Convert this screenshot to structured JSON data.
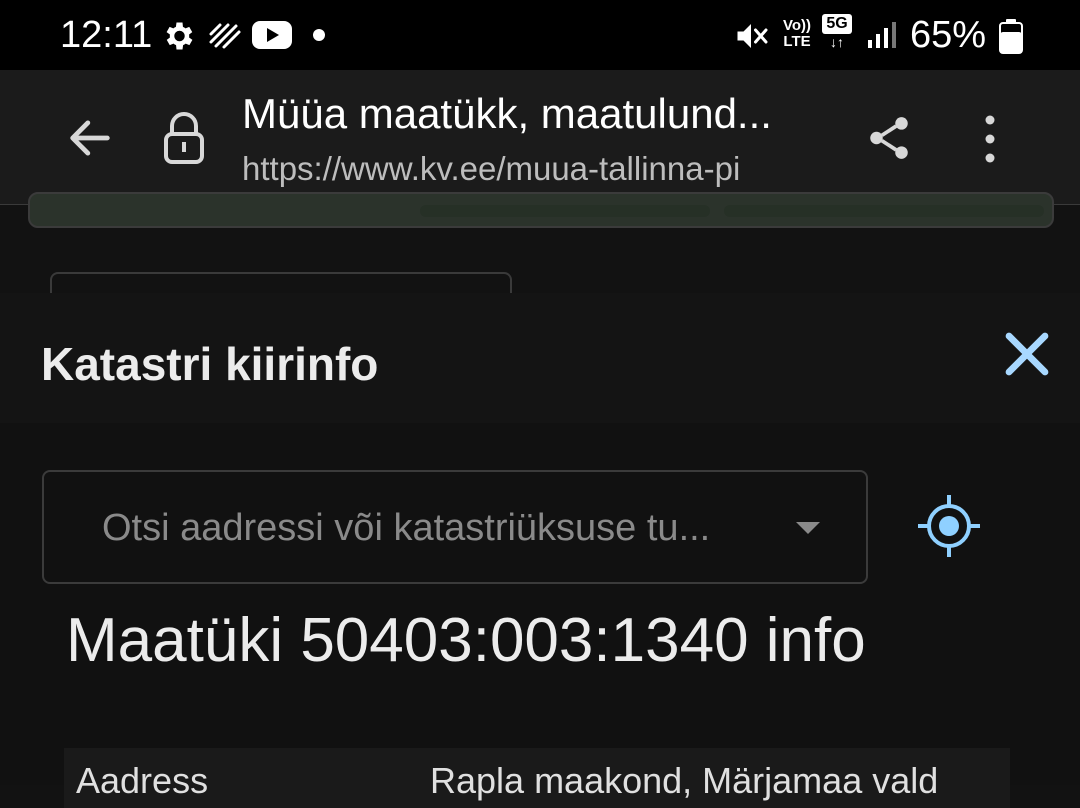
{
  "status_bar": {
    "time": "12:11",
    "battery_percent": "65%",
    "volte_label": "Vo)) LTE",
    "network_label": "5G",
    "icons": [
      "gear-icon",
      "signal-strip-icon",
      "youtube-icon",
      "dot-icon",
      "mute-icon",
      "volte-icon",
      "5g-icon",
      "cell-signal-icon",
      "battery-icon"
    ]
  },
  "browser": {
    "page_title": "Müüa maatükk, maatulund...",
    "url": "https://www.kv.ee/muua-tallinna-pi",
    "icons": [
      "back-arrow-icon",
      "lock-icon",
      "share-icon",
      "more-vert-icon"
    ]
  },
  "dialog": {
    "title": "Katastri kiirinfo",
    "close_icon": "close-icon",
    "search": {
      "placeholder": "Otsi aadressi või katastriüksuse tu...",
      "value": ""
    },
    "locate_icon": "my-location-icon",
    "parcel_heading": "Maatüki 50403:003:1340 info",
    "rows": [
      {
        "label": "Aadress",
        "value": "Rapla maakond, Märjamaa vald"
      }
    ]
  },
  "colors": {
    "background": "#121212",
    "accent_blue": "#8fd0ff",
    "close_blue": "#a8d8ff",
    "text": "#e6e6e6"
  }
}
